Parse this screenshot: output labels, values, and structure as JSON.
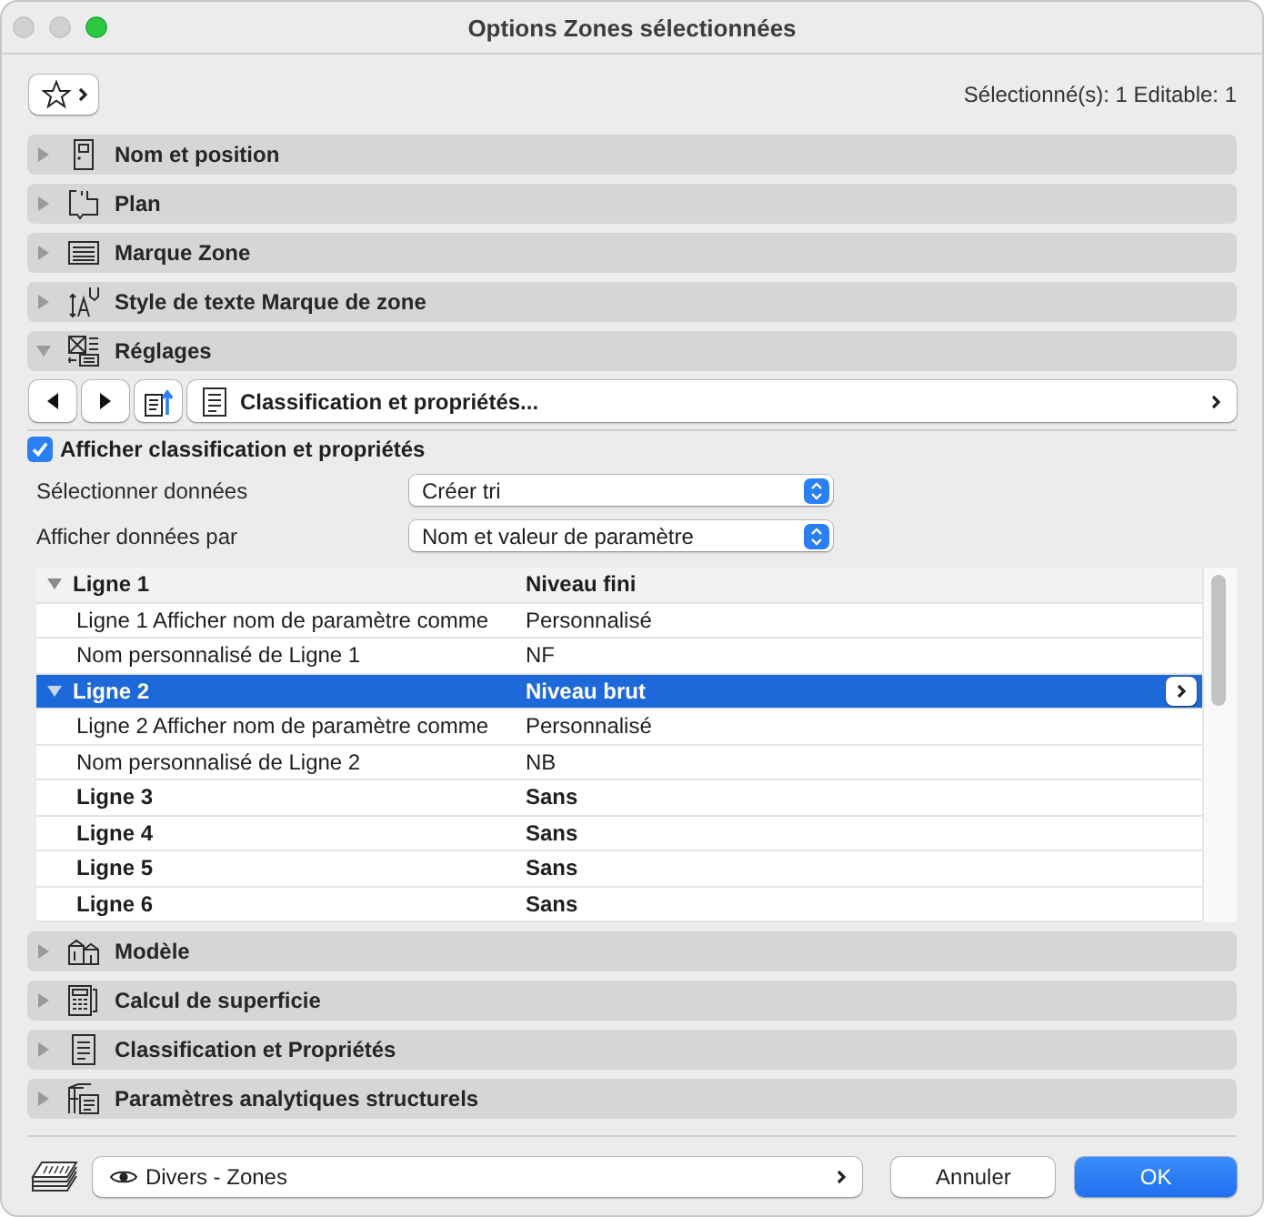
{
  "window": {
    "title": "Options Zones sélectionnées"
  },
  "toolbar": {
    "selection_info": "Sélectionné(s): 1 Editable: 1"
  },
  "sections": [
    {
      "label": "Nom et position",
      "expanded": false
    },
    {
      "label": "Plan",
      "expanded": false
    },
    {
      "label": "Marque Zone",
      "expanded": false
    },
    {
      "label": "Style de texte Marque de zone",
      "expanded": false
    },
    {
      "label": "Réglages",
      "expanded": true,
      "content": {
        "panel_selector": "Classification et propriétés...",
        "checkbox": {
          "label": "Afficher classification et propriétés",
          "checked": true
        },
        "fields": [
          {
            "label": "Sélectionner données",
            "value": "Créer tri"
          },
          {
            "label": "Afficher données par",
            "value": "Nom et valeur de paramètre"
          }
        ],
        "rows": [
          {
            "name": "Ligne 1",
            "value": "Niveau fini",
            "selected": false,
            "expanded": true,
            "children": [
              {
                "name": "Ligne 1 Afficher nom de paramètre comme",
                "value": "Personnalisé",
                "selected": false
              },
              {
                "name": "Nom personnalisé de Ligne 1",
                "value": "NF",
                "selected": false
              }
            ]
          },
          {
            "name": "Ligne 2",
            "value": "Niveau brut",
            "selected": true,
            "expanded": true,
            "children": [
              {
                "name": "Ligne 2 Afficher nom de paramètre comme",
                "value": "Personnalisé",
                "selected": false
              },
              {
                "name": "Nom personnalisé de Ligne 2",
                "value": "NB",
                "selected": false
              }
            ]
          },
          {
            "name": "Ligne 3",
            "value": "Sans",
            "selected": false
          },
          {
            "name": "Ligne 4",
            "value": "Sans",
            "selected": false
          },
          {
            "name": "Ligne 5",
            "value": "Sans",
            "selected": false
          },
          {
            "name": "Ligne 6",
            "value": "Sans",
            "selected": false
          }
        ]
      }
    },
    {
      "label": "Modèle",
      "expanded": false
    },
    {
      "label": "Calcul de superficie",
      "expanded": false
    },
    {
      "label": "Classification et Propriétés",
      "expanded": false
    },
    {
      "label": "Paramètres analytiques structurels",
      "expanded": false
    }
  ],
  "footer": {
    "layer": "Divers - Zones",
    "buttons": [
      {
        "label": "Annuler",
        "kind": "secondary"
      },
      {
        "label": "OK",
        "kind": "primary"
      }
    ]
  }
}
